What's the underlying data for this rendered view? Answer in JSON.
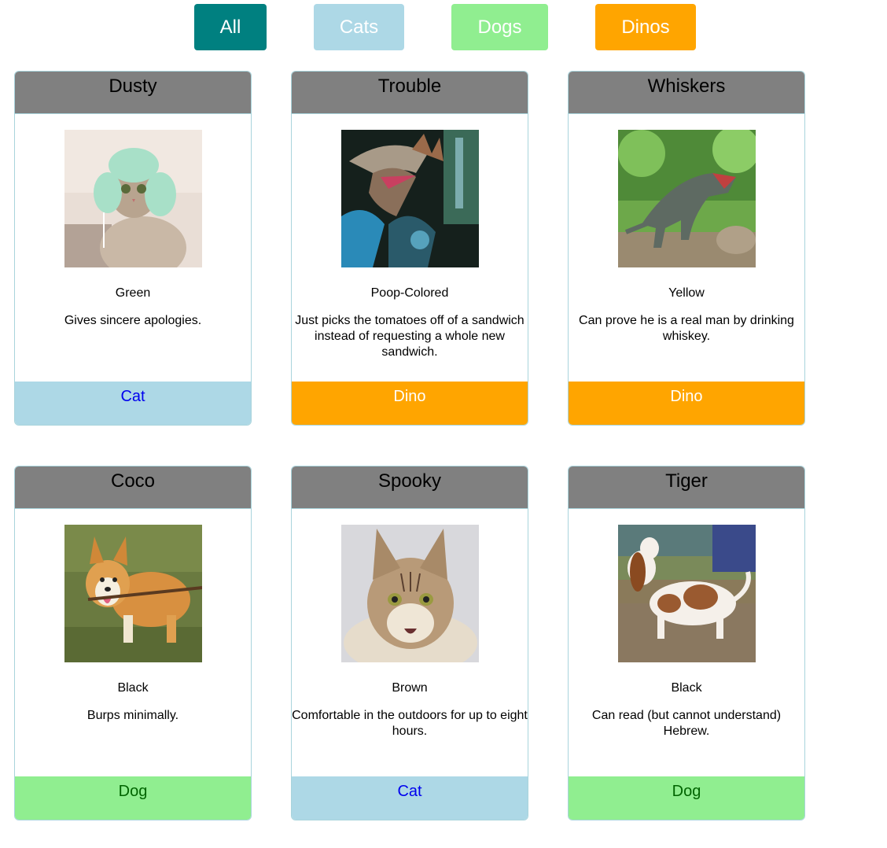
{
  "filters": {
    "all": "All",
    "cats": "Cats",
    "dogs": "Dogs",
    "dinos": "Dinos"
  },
  "colors": {
    "all": "#008080",
    "cats": "#add8e6",
    "dogs": "#90ee90",
    "dinos": "#ffa500",
    "header": "#808080"
  },
  "pets": [
    {
      "name": "Dusty",
      "photo": "cat-with-knitted-hat-photo",
      "color": "Green",
      "description": "Gives sincere apologies.",
      "type": "Cat"
    },
    {
      "name": "Trouble",
      "photo": "spinosaurus-model-photo",
      "color": "Poop-Colored",
      "description": "Just picks the tomatoes off of a sandwich instead of requesting a whole new sandwich.",
      "type": "Dino"
    },
    {
      "name": "Whiskers",
      "photo": "t-rex-in-forest-photo",
      "color": "Yellow",
      "description": "Can prove he is a real man by drinking whiskey.",
      "type": "Dino"
    },
    {
      "name": "Coco",
      "photo": "corgi-with-stick-photo",
      "color": "Black",
      "description": "Burps minimally.",
      "type": "Dog"
    },
    {
      "name": "Spooky",
      "photo": "maine-coon-cat-photo",
      "color": "Brown",
      "description": "Comfortable in the outdoors for up to eight hours.",
      "type": "Cat"
    },
    {
      "name": "Tiger",
      "photo": "basset-hound-photo",
      "color": "Black",
      "description": "Can read (but cannot understand) Hebrew.",
      "type": "Dog"
    }
  ]
}
